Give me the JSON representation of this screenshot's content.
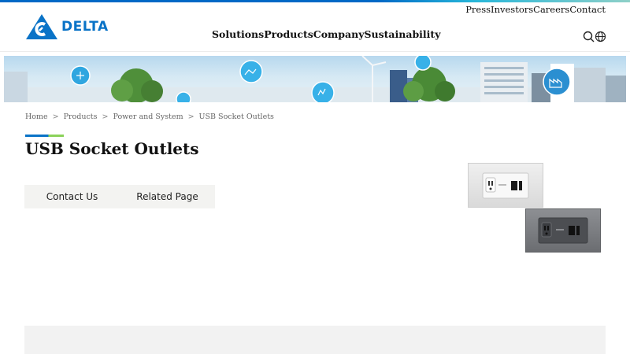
{
  "brand": {
    "name": "DELTA",
    "accent": "#0a73c7",
    "accent_green": "#8bd25a"
  },
  "utility_nav": [
    "Press",
    "Investors",
    "Careers",
    "Contact"
  ],
  "main_nav": [
    "Solutions",
    "Products",
    "Company",
    "Sustainability"
  ],
  "header_icons": [
    "search-icon",
    "globe-icon"
  ],
  "breadcrumb": [
    "Home",
    "Products",
    "Power and System",
    "USB Socket Outlets"
  ],
  "breadcrumb_separator": ">",
  "page_title": "USB Socket Outlets",
  "tabs": [
    "Contact Us",
    "Related Page"
  ],
  "products": [
    "white-usb-socket-outlet-image",
    "gray-usb-socket-outlet-image"
  ]
}
